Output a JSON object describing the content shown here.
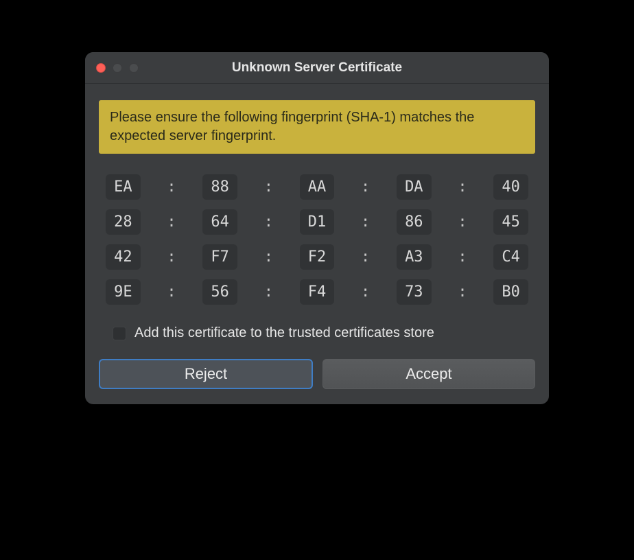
{
  "window": {
    "title": "Unknown Server Certificate"
  },
  "notice": {
    "text": "Please ensure the following fingerprint (SHA-1) matches the expected server fingerprint."
  },
  "fingerprint": {
    "separator": ":",
    "bytes": [
      [
        "EA",
        "88",
        "AA",
        "DA",
        "40"
      ],
      [
        "28",
        "64",
        "D1",
        "86",
        "45"
      ],
      [
        "42",
        "F7",
        "F2",
        "A3",
        "C4"
      ],
      [
        "9E",
        "56",
        "F4",
        "73",
        "B0"
      ]
    ]
  },
  "checkbox": {
    "label": "Add this certificate to the trusted certificates store",
    "checked": false
  },
  "buttons": {
    "reject": "Reject",
    "accept": "Accept"
  }
}
